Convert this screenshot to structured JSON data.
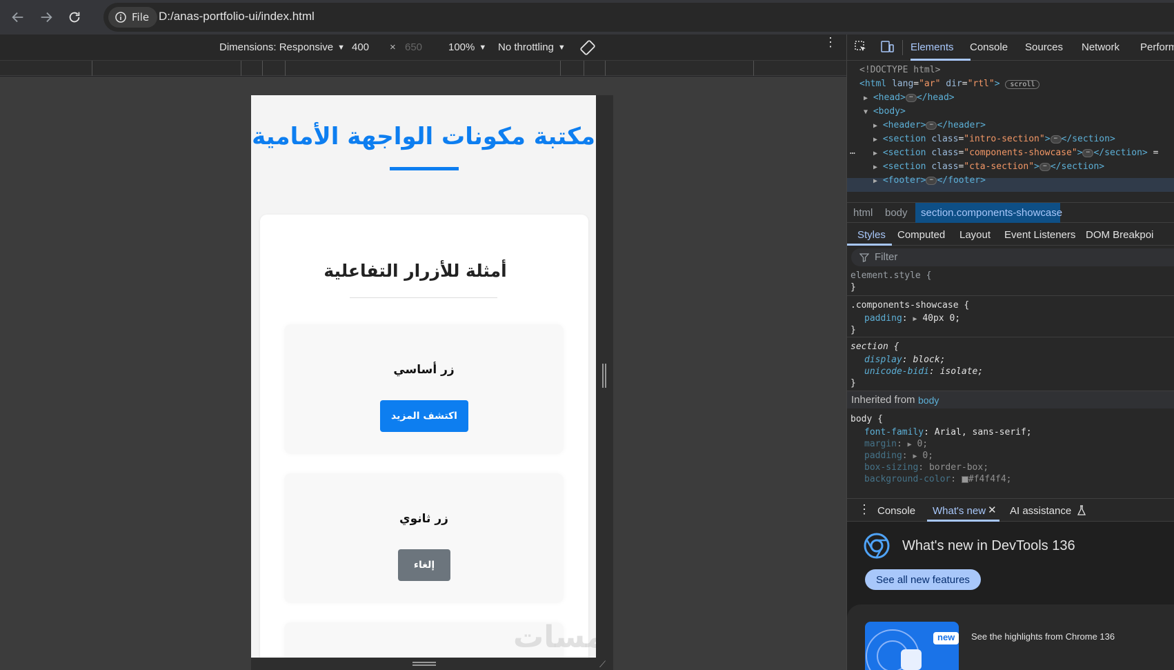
{
  "browser": {
    "file_chip": "File",
    "url": "D:/anas-portfolio-ui/index.html"
  },
  "device_toolbar": {
    "dimensions_label": "Dimensions: Responsive",
    "width": "400",
    "times": "×",
    "height": "650",
    "zoom": "100%",
    "throttle": "No throttling"
  },
  "page": {
    "title": "مكتبة مكونات الواجهة الأمامية",
    "card_title": "أمثلة للأزرار التفاعلية",
    "items": [
      {
        "label": "زر أساسي",
        "button": "اكتشف المزيد",
        "color": "#0d7ef0"
      },
      {
        "label": "زر ثانوي",
        "button": "إلغاء",
        "color": "#6c757d"
      }
    ],
    "watermark": "خمسات"
  },
  "devtools": {
    "tabs": [
      "Elements",
      "Console",
      "Sources",
      "Network",
      "Perform"
    ],
    "dom": {
      "doctype": "<!DOCTYPE html>",
      "html_open": "<html",
      "html_lang_attr": "lang",
      "html_lang_val": "\"ar\"",
      "html_dir_attr": "dir",
      "html_dir_val": "\"rtl\"",
      "scroll_badge": "scroll",
      "head_open": "<head>",
      "head_close": "</head>",
      "body_open": "<body>",
      "header_open": "<header>",
      "header_close": "</header>",
      "section_open": "<section",
      "class_attr": "class",
      "intro_val": "\"intro-section\"",
      "showcase_val": "\"components-showcase\"",
      "cta_val": "\"cta-section\"",
      "section_close": "</section>",
      "showcase_suffix": "=",
      "footer_open": "<footer>",
      "footer_close": "</footer>",
      "gt": ">",
      "ellipsis": "⋯",
      "dots": "…"
    },
    "breadcrumbs": [
      "html",
      "body",
      "section.components-showcase"
    ],
    "style_tabs": [
      "Styles",
      "Computed",
      "Layout",
      "Event Listeners",
      "DOM Breakpoi"
    ],
    "filter_placeholder": "Filter",
    "styles": {
      "element_style": "element.style {",
      "close": "}",
      "showcase_sel": ".components-showcase {",
      "padding_prop": "padding",
      "padding_val": "40px 0;",
      "section_sel": "section {",
      "display_prop": "display",
      "display_val": "block;",
      "bidi_prop": "unicode-bidi",
      "bidi_val": "isolate;",
      "inherited_label": "Inherited from",
      "inherited_from": "body",
      "body_sel": "body {",
      "font_prop": "font-family",
      "font_val": "Arial, sans-serif;",
      "margin_prop": "margin",
      "margin_val": "0;",
      "padding2_prop": "padding",
      "padding2_val": "0;",
      "boxsizing_prop": "box-sizing",
      "boxsizing_val": "border-box;",
      "bg_prop": "background-color",
      "bg_val": "#f4f4f4;",
      "colon": ":"
    },
    "drawer_tabs": [
      "Console",
      "What's new",
      "AI assistance"
    ],
    "whats_new_title": "What's new in DevTools 136",
    "whats_new_button": "See all new features",
    "new_badge": "new",
    "highlight_text": "See the highlights from Chrome 136"
  }
}
